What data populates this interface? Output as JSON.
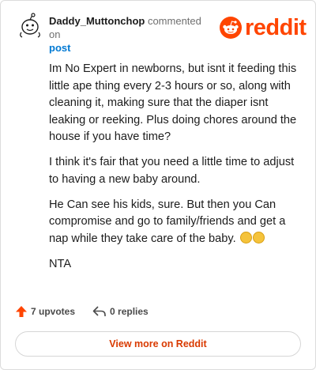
{
  "header": {
    "author": "Daddy_Muttonchop",
    "action_text": "commented on",
    "post_link": "post"
  },
  "logo": {
    "wordmark": "reddit",
    "icon": "reddit-snoo-icon",
    "color": "#ff4500"
  },
  "comment": {
    "paragraphs": [
      "Im No Expert in newborns, but isnt it feeding this little ape thing every 2-3 hours or so, along with cleaning it, making sure that the diaper isnt leaking or reeking. Plus doing chores around the house if you have time?",
      "I think it's fair that you need a little time to adjust to having a new baby around.",
      "He Can see his kids, sure. But then you Can compromise and go to family/friends and get a nap while they take care of the baby.",
      "NTA"
    ],
    "emoji": [
      "winking-face-icon",
      "winking-face-icon"
    ]
  },
  "footer": {
    "upvotes": "7 upvotes",
    "replies": "0 replies",
    "view_more": "View more on Reddit"
  },
  "colors": {
    "accent": "#ff4500",
    "link": "#0079d3",
    "button_text": "#d93a00"
  }
}
